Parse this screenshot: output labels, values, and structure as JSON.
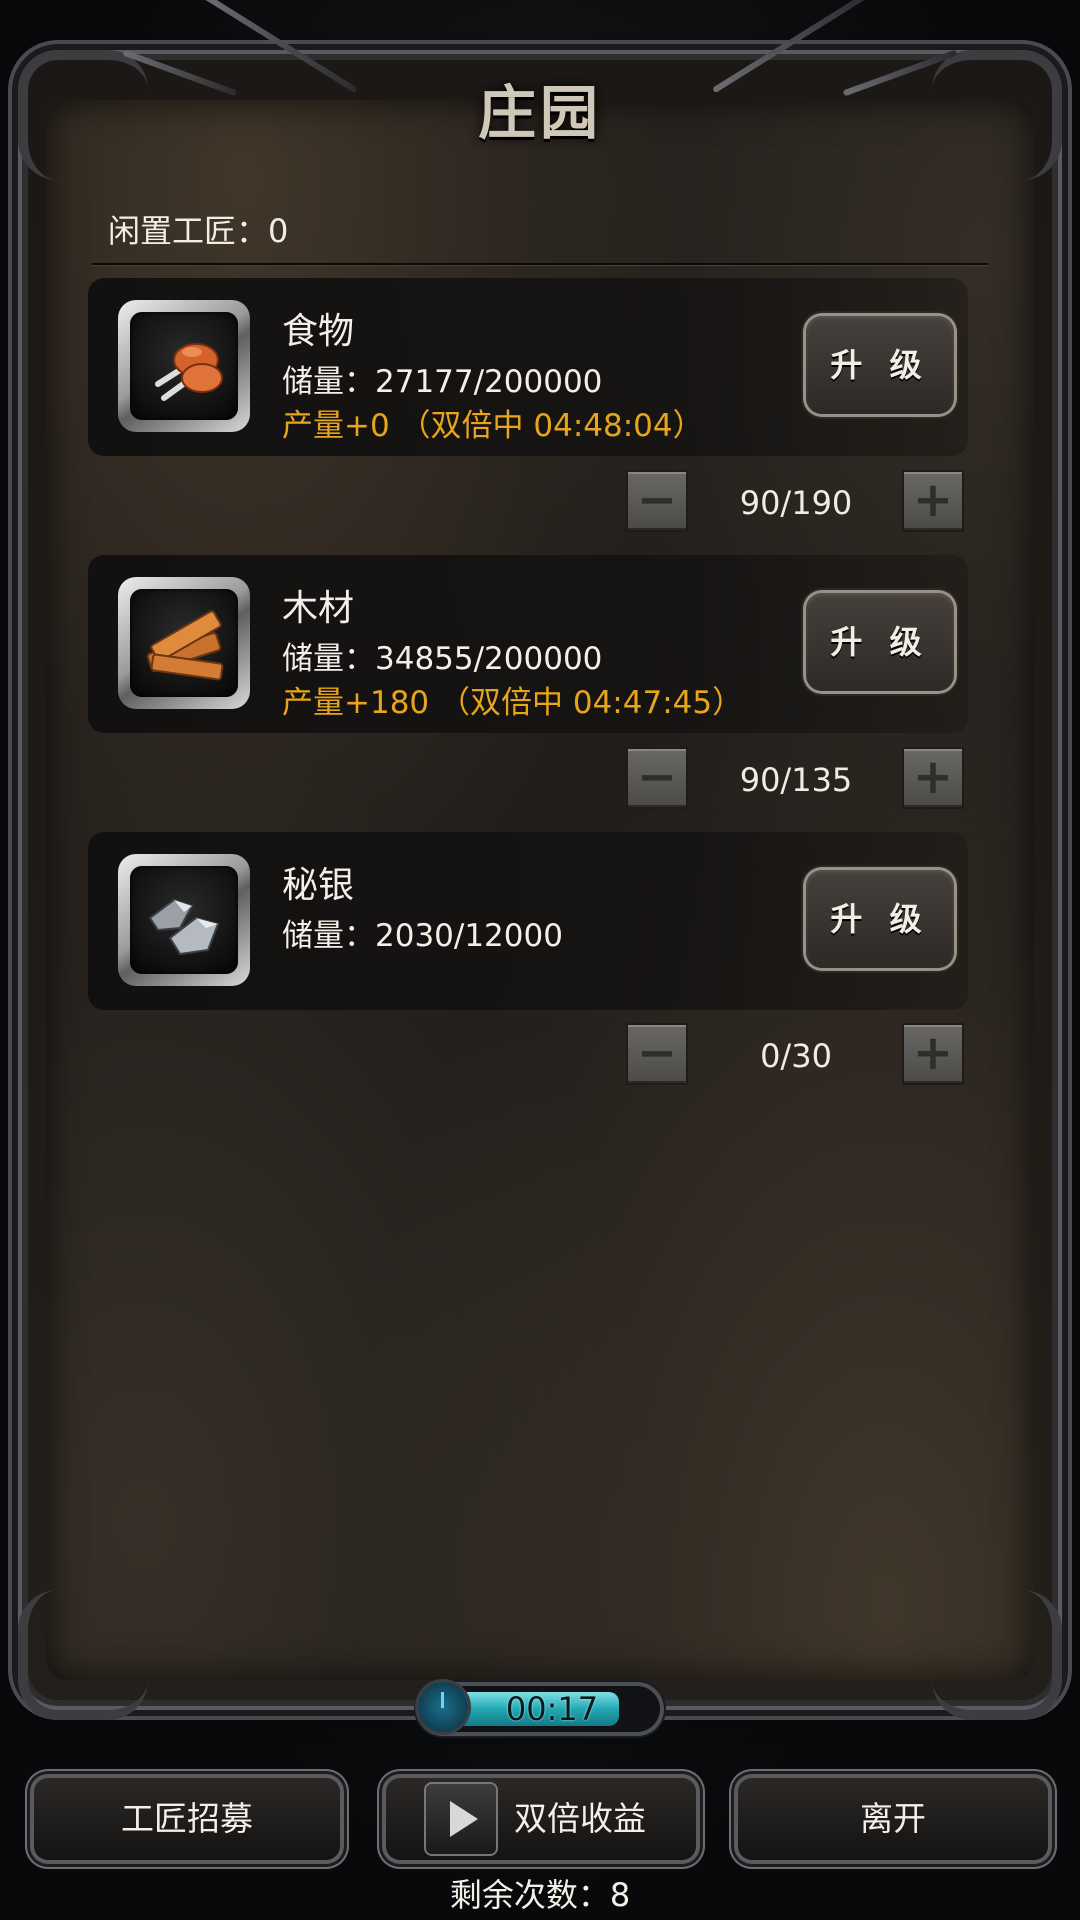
{
  "title": "庄园",
  "idle_label": "闲置工匠：",
  "idle_count": "0",
  "resources": [
    {
      "name": "食物",
      "stock": "储量：27177/200000",
      "production": "产量+0 （双倍中 04:48:04）",
      "upgrade": "升 级",
      "workers": "90/190",
      "icon": "meat-icon"
    },
    {
      "name": "木材",
      "stock": "储量：34855/200000",
      "production": "产量+180 （双倍中 04:47:45）",
      "upgrade": "升 级",
      "workers": "90/135",
      "icon": "wood-planks-icon"
    },
    {
      "name": "秘银",
      "stock": "储量：2030/12000",
      "production": "",
      "upgrade": "升 级",
      "workers": "0/30",
      "icon": "mithril-ore-icon"
    }
  ],
  "stepper": {
    "minus": "−",
    "plus": "+"
  },
  "timer": {
    "value": "00:17",
    "progress": 0.85
  },
  "buttons": {
    "recruit": "工匠招募",
    "double": "双倍收益",
    "leave": "离开"
  },
  "remaining": "剩余次数：8",
  "colors": {
    "production": "#e7a51c",
    "timer_fill": "#22a8b3"
  }
}
